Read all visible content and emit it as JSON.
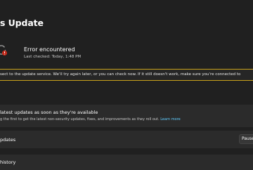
{
  "page": {
    "title": "s Update"
  },
  "status": {
    "icon": "sync-error-icon",
    "title": "Error encountered",
    "last_checked": "Last checked: Today, 1:48 PM"
  },
  "error": {
    "message": "sect to the update service. We'll try again later, or you can check now. If it still doesn't work, make sure you're connected to"
  },
  "latest_updates": {
    "title": " latest updates as soon as they're available",
    "description": "g the first to get the latest non-security updates, fixes, and improvements as they roll out.",
    "learn_more": "Learn more"
  },
  "pause": {
    "label": "pdates",
    "button": "Pause"
  },
  "history": {
    "label": " history"
  },
  "colors": {
    "background": "#202020",
    "card": "#2b2b2b",
    "warning_border": "#c8a21a",
    "link": "#60cdff"
  }
}
